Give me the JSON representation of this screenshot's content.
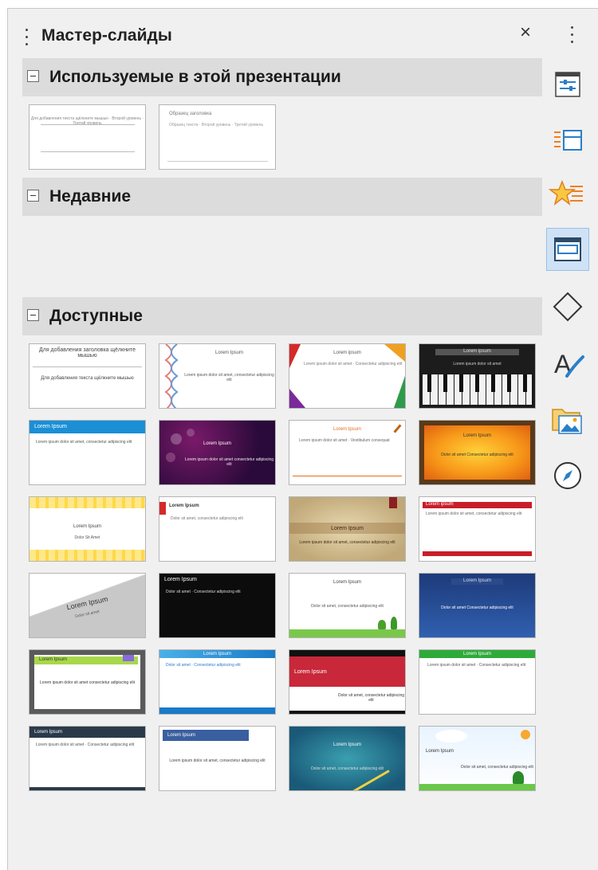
{
  "panel": {
    "title": "Мастер-слайды",
    "close_glyph": "×"
  },
  "sections": {
    "used": {
      "label": "Используемые в этой презентации"
    },
    "recent": {
      "label": "Недавние"
    },
    "available": {
      "label": "Доступные"
    }
  },
  "used_thumbs": [
    {
      "title": "",
      "body": "Для добавления текста щёлкните мышью · Второй уровень · Третий уровень"
    },
    {
      "title": "Образец заголовка",
      "body": "Образец текста · Второй уровень · Третий уровень"
    }
  ],
  "available_thumbs": [
    {
      "title": "Для добавления заголовка щёлкните мышью",
      "body": "Для добавления текста щёлкните мышью"
    },
    {
      "title": "Lorem Ipsum",
      "body": "Lorem ipsum dolor sit amet, consectetur adipiscing elit"
    },
    {
      "title": "Lorem ipsum",
      "body": "Lorem ipsum dolor sit amet · Consectetur adipiscing elit"
    },
    {
      "title": "Lorem ipsum",
      "body": "Lorem ipsum dolor sit amet"
    },
    {
      "title": "Lorem Ipsum",
      "body": "Lorem ipsum dolor sit amet, consectetur adipiscing elit"
    },
    {
      "title": "Lorem Ipsum",
      "body": "Lorem ipsum dolor sit amet consectetur adipiscing elit"
    },
    {
      "title": "Lorem Ipsum",
      "body": "Lorem ipsum dolor sit amet · Vestibulum consequat"
    },
    {
      "title": "Lorem Ipsum",
      "body": "Dolor sit amet Consectetur adipiscing elit"
    },
    {
      "title": "Lorem Ipsum",
      "body": "Dolor Sit Amet"
    },
    {
      "title": "Lorem Ipsum",
      "body": "Dolor sit amet, consectetur adipiscing elit"
    },
    {
      "title": "Lorem Ipsum",
      "body": "Lorem ipsum dolor sit amet, consectetur adipiscing elit"
    },
    {
      "title": "Lorem ipsum",
      "body": "Lorem ipsum dolor sit amet, consectetur adipiscing elit"
    },
    {
      "title": "Lorem Ipsum",
      "body": "Dolor sit amet"
    },
    {
      "title": "Lorem Ipsum",
      "body": "Dolor sit amet · Consectetur adipiscing elit"
    },
    {
      "title": "Lorem Ipsum",
      "body": "Dolor sit amet, consectetur adipiscing elit"
    },
    {
      "title": "Lorem Ipsum",
      "body": "Dolor sit amet Consectetur adipiscing elit"
    },
    {
      "title": "Lorem Ipsum",
      "body": "Lorem ipsum dolor sit amet consectetur adipiscing elit"
    },
    {
      "title": "Lorem Ipsum",
      "body": "Dolor sit amet · Consectetur adipiscing elit"
    },
    {
      "title": "Lorem Ipsum",
      "body": "Dolor sit amet, consectetur adipiscing elit"
    },
    {
      "title": "Lorem Ipsum",
      "body": "Lorem ipsum dolor sit amet · Consectetur adipiscing elit"
    },
    {
      "title": "Lorem Ipsum",
      "body": "Lorem ipsum dolor sit amet · Consectetur adipiscing elit"
    },
    {
      "title": "Lorem Ipsum",
      "body": "Lorem ipsum dolor sit amet, consectetur adipiscing elit"
    },
    {
      "title": "Lorem Ipsum",
      "body": "Dolor sit amet, consectetur adipiscing elit"
    },
    {
      "title": "Lorem Ipsum",
      "body": "Dolor sit amet, consectetur adipiscing elit"
    }
  ],
  "sidebar_tabs": [
    {
      "name": "properties-tab",
      "icon": "properties-icon"
    },
    {
      "name": "slide-transition-tab",
      "icon": "slide-transition-icon"
    },
    {
      "name": "animation-tab",
      "icon": "animation-star-icon"
    },
    {
      "name": "master-slides-tab",
      "icon": "master-slides-icon"
    },
    {
      "name": "shapes-tab",
      "icon": "diamond-shape-icon"
    },
    {
      "name": "styles-tab",
      "icon": "styles-brush-icon"
    },
    {
      "name": "gallery-tab",
      "icon": "gallery-folder-icon"
    },
    {
      "name": "navigator-tab",
      "icon": "navigator-compass-icon"
    }
  ],
  "colors": {
    "panel_bg": "#f0f0f0",
    "section_header_bg": "#dcdcdc",
    "active_tab_bg": "#cfe2f5",
    "icon_blue": "#2a7fc8"
  }
}
